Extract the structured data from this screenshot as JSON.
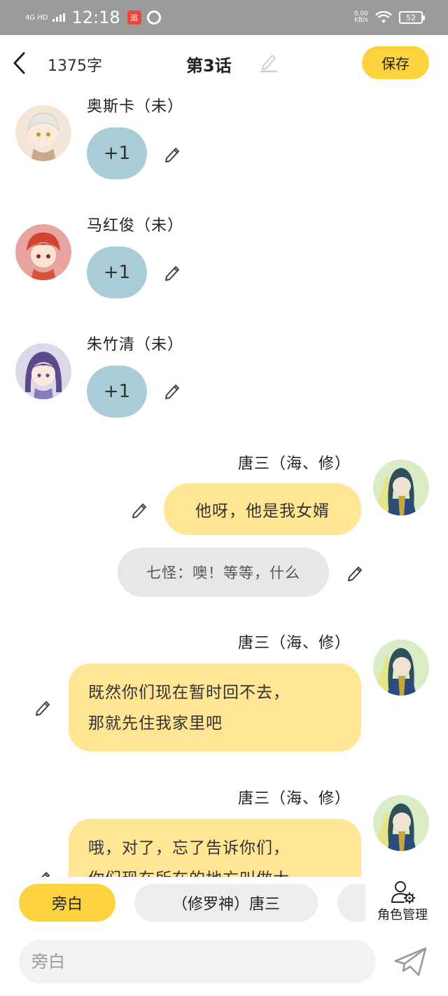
{
  "status_bar": {
    "network": "4G HD",
    "time": "12:18",
    "app_badge_text": "追",
    "speed_value": "0.00",
    "speed_unit": "KB/s",
    "battery": "52"
  },
  "header": {
    "word_count": "1375字",
    "title": "第3话",
    "save_label": "保存"
  },
  "messages": [
    {
      "side": "left",
      "name": "奥斯卡（未）",
      "kind": "plus",
      "text": "+1",
      "avatar_color": "#f3e6d8"
    },
    {
      "side": "left",
      "name": "马红俊（未）",
      "kind": "plus",
      "text": "+1",
      "avatar_color": "#e9a3a0"
    },
    {
      "side": "left",
      "name": "朱竹清（未）",
      "kind": "plus",
      "text": "+1",
      "avatar_color": "#dcd8ea"
    },
    {
      "side": "right",
      "name": "唐三（海、修）",
      "kind": "bubble",
      "lines": [
        "他呀，他是我女婿"
      ]
    },
    {
      "side": "center",
      "kind": "narration",
      "text": "七怪：噢！等等，什么"
    },
    {
      "side": "right",
      "name": "唐三（海、修）",
      "kind": "bubble",
      "lines": [
        "既然你们现在暂时回不去，",
        "那就先住我家里吧"
      ]
    },
    {
      "side": "right",
      "name": "唐三（海、修）",
      "kind": "bubble",
      "lines": [
        "哦，对了，忘了告诉你们，",
        "你们现在所在的地方叫做大"
      ]
    }
  ],
  "role_bar": {
    "chips": [
      "旁白",
      "（修罗神）唐三"
    ],
    "active_index": 0,
    "manage_label": "角色管理"
  },
  "input": {
    "placeholder": "旁白"
  },
  "colors": {
    "accent_yellow": "#fcd23f",
    "bubble_yellow": "#ffe594",
    "bubble_blue": "#a9ccd6",
    "narration_gray": "#e7e7e7",
    "status_bar_gray": "#9b9b9b"
  },
  "icons": {
    "back": "chevron-left-icon",
    "edit": "pencil-icon",
    "manage": "user-gear-icon",
    "send": "paper-plane-icon"
  }
}
